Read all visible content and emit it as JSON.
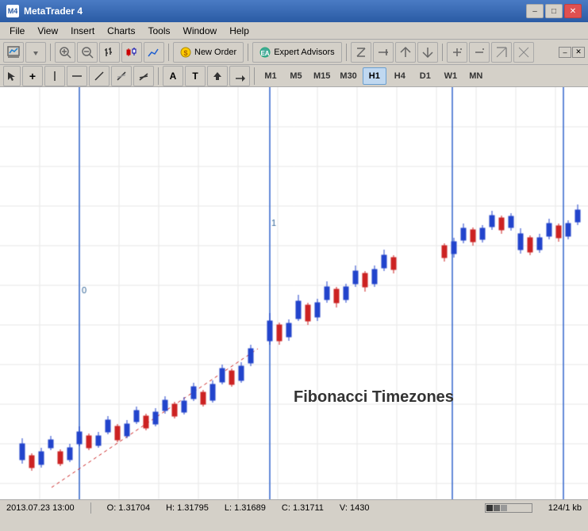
{
  "titleBar": {
    "title": "MetaTrader 4",
    "icon": "MT4",
    "minimizeLabel": "–",
    "maximizeLabel": "□",
    "closeLabel": "✕"
  },
  "menu": {
    "items": [
      "File",
      "View",
      "Insert",
      "Charts",
      "Tools",
      "Window",
      "Help"
    ]
  },
  "toolbar1": {
    "newOrderLabel": "New Order",
    "expertAdvisorsLabel": "Expert Advisors"
  },
  "toolbar2": {
    "timeframes": [
      "M1",
      "M5",
      "M15",
      "M30",
      "H1",
      "H4",
      "D1",
      "W1",
      "MN"
    ],
    "activeTimeframe": "H1"
  },
  "chart": {
    "fibLabel": "Fibonacci Timezones",
    "verticalLine0Label": "0",
    "verticalLine1Label": "1"
  },
  "statusBar": {
    "datetime": "2013.07.23 13:00",
    "open": "O: 1.31704",
    "high": "H: 1.31795",
    "low": "L: 1.31689",
    "close": "C: 1.31711",
    "volume": "V: 1430",
    "fileInfo": "124/1 kb"
  },
  "innerWindow": {
    "minimizeLabel": "–",
    "closeLabel": "✕"
  }
}
